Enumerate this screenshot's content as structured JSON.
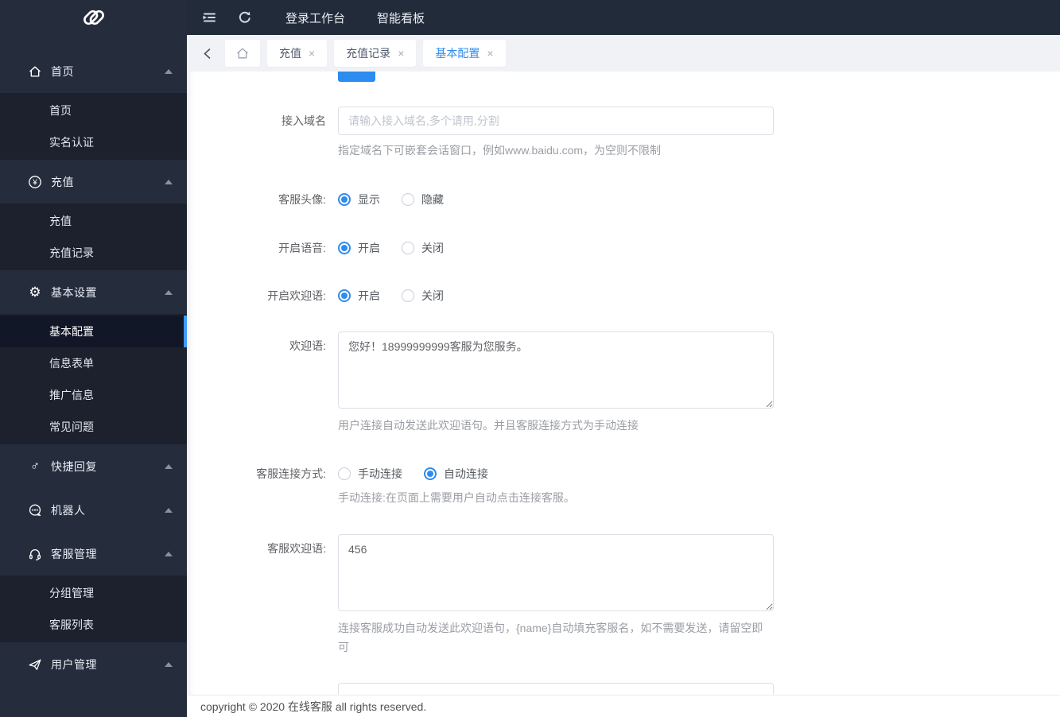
{
  "topbar": {
    "menu_items": [
      {
        "label": "登录工作台"
      },
      {
        "label": "智能看板"
      }
    ]
  },
  "sidebar": {
    "sections": [
      {
        "label": "首页",
        "icon": "home-icon",
        "expanded": true,
        "children": [
          {
            "label": "首页"
          },
          {
            "label": "实名认证"
          }
        ]
      },
      {
        "label": "充值",
        "icon": "yen-icon",
        "expanded": true,
        "children": [
          {
            "label": "充值"
          },
          {
            "label": "充值记录"
          }
        ]
      },
      {
        "label": "基本设置",
        "icon": "gear-icon",
        "expanded": true,
        "children": [
          {
            "label": "基本配置",
            "active": true
          },
          {
            "label": "信息表单"
          },
          {
            "label": "推广信息"
          },
          {
            "label": "常见问题"
          }
        ]
      },
      {
        "label": "快捷回复",
        "icon": "quick-reply-icon",
        "expanded": true,
        "children": []
      },
      {
        "label": "机器人",
        "icon": "robot-icon",
        "expanded": true,
        "children": []
      },
      {
        "label": "客服管理",
        "icon": "headset-icon",
        "expanded": true,
        "children": [
          {
            "label": "分组管理"
          },
          {
            "label": "客服列表"
          }
        ]
      },
      {
        "label": "用户管理",
        "icon": "paper-plane-icon",
        "expanded": true,
        "children": []
      }
    ]
  },
  "tabbar": {
    "close_glyph": "×",
    "tabs": [
      {
        "label": "充值",
        "active": false
      },
      {
        "label": "充值记录",
        "active": false
      },
      {
        "label": "基本配置",
        "active": true
      }
    ]
  },
  "form": {
    "fields": [
      {
        "type": "input",
        "label": "接入域名",
        "value": "",
        "placeholder": "请输入接入域名,多个请用,分割",
        "hint": "指定域名下可嵌套会话窗口，例如www.baidu.com，为空则不限制"
      },
      {
        "type": "radio",
        "label": "客服头像:",
        "options": [
          "显示",
          "隐藏"
        ],
        "selected": "显示"
      },
      {
        "type": "radio",
        "label": "开启语音:",
        "options": [
          "开启",
          "关闭"
        ],
        "selected": "开启"
      },
      {
        "type": "radio",
        "label": "开启欢迎语:",
        "options": [
          "开启",
          "关闭"
        ],
        "selected": "开启"
      },
      {
        "type": "textarea",
        "label": "欢迎语:",
        "value": "您好！18999999999客服为您服务。",
        "hint": "用户连接自动发送此欢迎语句。并且客服连接方式为手动连接"
      },
      {
        "type": "radio",
        "label": "客服连接方式:",
        "options": [
          "手动连接",
          "自动连接"
        ],
        "selected": "自动连接",
        "hint": "手动连接:在页面上需要用户自动点击连接客服。"
      },
      {
        "type": "textarea",
        "label": "客服欢迎语:",
        "value": "456",
        "hint": "连接客服成功自动发送此欢迎语句，{name}自动填充客服名，如不需要发送，请留空即可"
      }
    ]
  },
  "footer": {
    "text": "copyright © 2020 在线客服 all rights reserved."
  },
  "colors": {
    "accent": "#2d8cf0",
    "sidebar_bg": "#252d3d",
    "submenu_bg": "#1c212d",
    "active_item_bg": "#111726",
    "active_bar": "#3d9bff",
    "topbar_bg": "#222b3a",
    "tabbar_bg": "#f0f2f5"
  }
}
